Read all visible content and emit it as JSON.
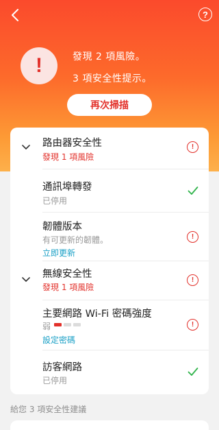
{
  "header": {
    "back_icon": "chevron-left-icon",
    "help_icon": "question-circle-icon",
    "help_glyph": "?",
    "alert_glyph": "!",
    "risk_summary": "發現 2 項風險。",
    "tip_summary": "3 項安全性提示。",
    "rescan_label": "再次掃描"
  },
  "sections": [
    {
      "title": "路由器安全性",
      "subtitle": "發現 1 項風險",
      "status": "alert",
      "items": [
        {
          "title": "通訊埠轉發",
          "subtitle": "已停用",
          "status": "ok"
        },
        {
          "title": "韌體版本",
          "subtitle": "有可更新的韌體。",
          "link": "立即更新",
          "status": "alert"
        }
      ]
    },
    {
      "title": "無線安全性",
      "subtitle": "發現 1 項風險",
      "status": "alert",
      "items": [
        {
          "title": "主要網路 Wi-Fi 密碼強度",
          "strength_label": "弱",
          "strength_level": 1,
          "strength_max": 3,
          "link": "設定密碼",
          "status": "alert"
        },
        {
          "title": "訪客網路",
          "subtitle": "已停用",
          "status": "ok"
        }
      ]
    }
  ],
  "footer": {
    "suggestions": "給您 3 項安全性建議"
  },
  "colors": {
    "accent_red": "#e2302a",
    "ok_green": "#2fb34a",
    "link_blue": "#1aa0c6",
    "hero_top": "#fb4a2c",
    "hero_bottom": "#fdb04b"
  }
}
